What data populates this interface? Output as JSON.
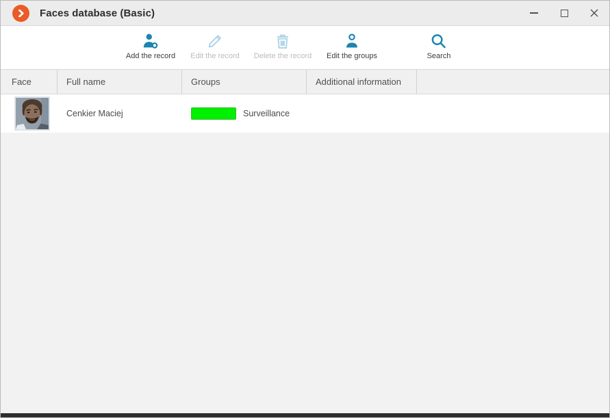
{
  "titlebar": {
    "title": "Faces database (Basic)"
  },
  "toolbar": {
    "buttons": [
      {
        "label": "Add the record",
        "icon": "person-add-icon",
        "enabled": true
      },
      {
        "label": "Edit the record",
        "icon": "pencil-icon",
        "enabled": false
      },
      {
        "label": "Delete the record",
        "icon": "trash-icon",
        "enabled": false
      },
      {
        "label": "Edit the groups",
        "icon": "person-icon",
        "enabled": true
      },
      {
        "label": "Search",
        "icon": "search-icon",
        "enabled": true
      }
    ]
  },
  "table": {
    "columns": [
      "Face",
      "Full name",
      "Groups",
      "Additional information"
    ],
    "rows": [
      {
        "full_name": "Cenkier Maciej",
        "groups": [
          {
            "label": "Surveillance",
            "color": "#00f000"
          }
        ],
        "additional_information": ""
      }
    ]
  },
  "colors": {
    "accent_teal": "#1b85ae",
    "accent_disabled": "#a9d2e5",
    "app_icon_orange": "#ea5b27",
    "group_swatch_green": "#00f000",
    "titlebar_bg": "#ececec",
    "header_bg": "#f0f0f0",
    "body_bg": "#f2f2f2"
  }
}
